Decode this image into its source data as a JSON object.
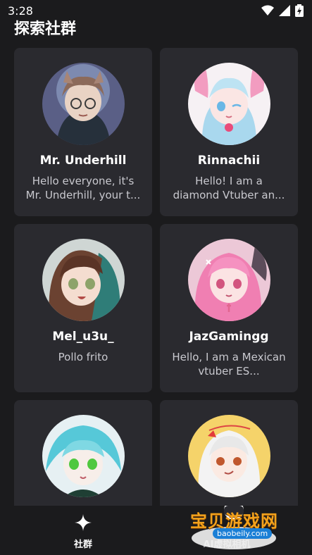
{
  "status": {
    "time": "3:28"
  },
  "page": {
    "title": "探索社群"
  },
  "cards": [
    {
      "name": "Mr. Underhill",
      "description": "Hello everyone, it's Mr. Underhill, your t..."
    },
    {
      "name": "Rinnachii",
      "description": "Hello! I am a diamond Vtuber an..."
    },
    {
      "name": "Mel_u3u_",
      "description": "Pollo frito"
    },
    {
      "name": "JazGamingg",
      "description": "Hello, I am a Mexican vtuber ES..."
    },
    {
      "name": "",
      "description": ""
    },
    {
      "name": "",
      "description": ""
    }
  ],
  "nav": {
    "community_label": "社群",
    "second_label": "AI虚拟相机"
  },
  "watermark": {
    "title": "宝贝游戏网",
    "url": "baobeily.com"
  },
  "colors": {
    "background": "#1b1b1d",
    "card": "#2a2a2f",
    "text_secondary": "#c9c9cf"
  }
}
